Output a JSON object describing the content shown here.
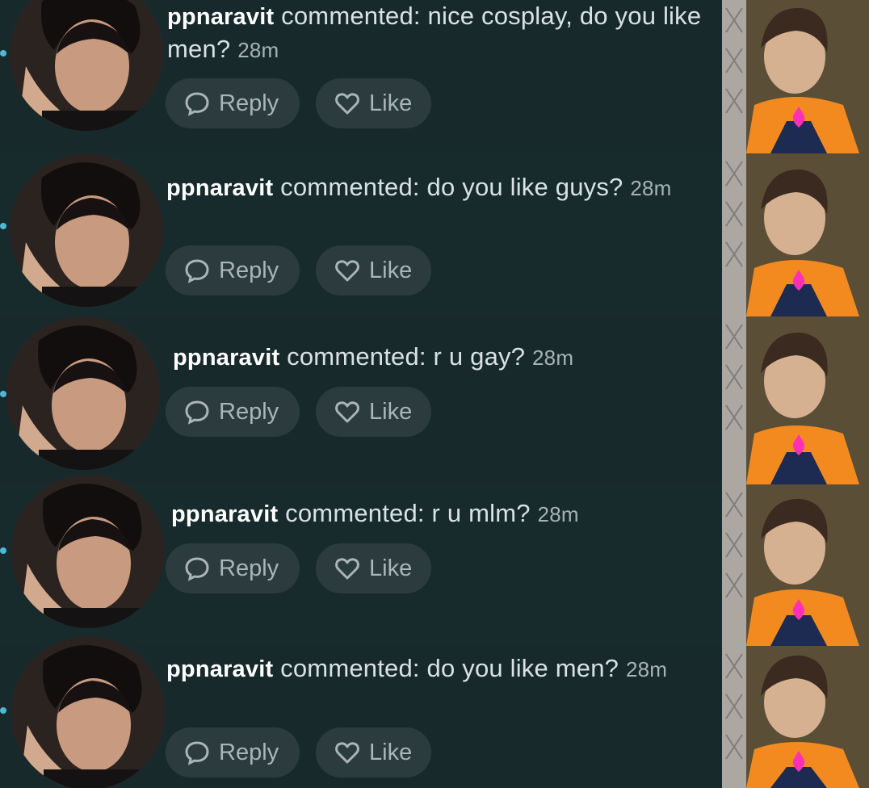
{
  "colors": {
    "background": "#17292c",
    "pill": "#2c3c3e",
    "unread_dot": "#4fb8d6",
    "username": "#ffffff",
    "comment_text": "#d9e2e3"
  },
  "icons": {
    "reply": "speech-bubble-icon",
    "like": "heart-icon",
    "thumbnail_overlay": "pink-heart-icon"
  },
  "notifications": [
    {
      "username": "ppnaravit",
      "text": " commented: nice cosplay, do you like men?",
      "time": "28m",
      "reply_label": "Reply",
      "like_label": "Like"
    },
    {
      "username": "ppnaravit",
      "text": " commented: do you like guys?",
      "time": "28m",
      "reply_label": "Reply",
      "like_label": "Like"
    },
    {
      "username": "ppnaravit",
      "text": " commented: r u gay?",
      "time": "28m",
      "reply_label": "Reply",
      "like_label": "Like"
    },
    {
      "username": "ppnaravit",
      "text": " commented: r u mlm?",
      "time": "28m",
      "reply_label": "Reply",
      "like_label": "Like"
    },
    {
      "username": "ppnaravit",
      "text": " commented: do you like men?",
      "time": "28m",
      "reply_label": "Reply",
      "like_label": "Like"
    }
  ]
}
